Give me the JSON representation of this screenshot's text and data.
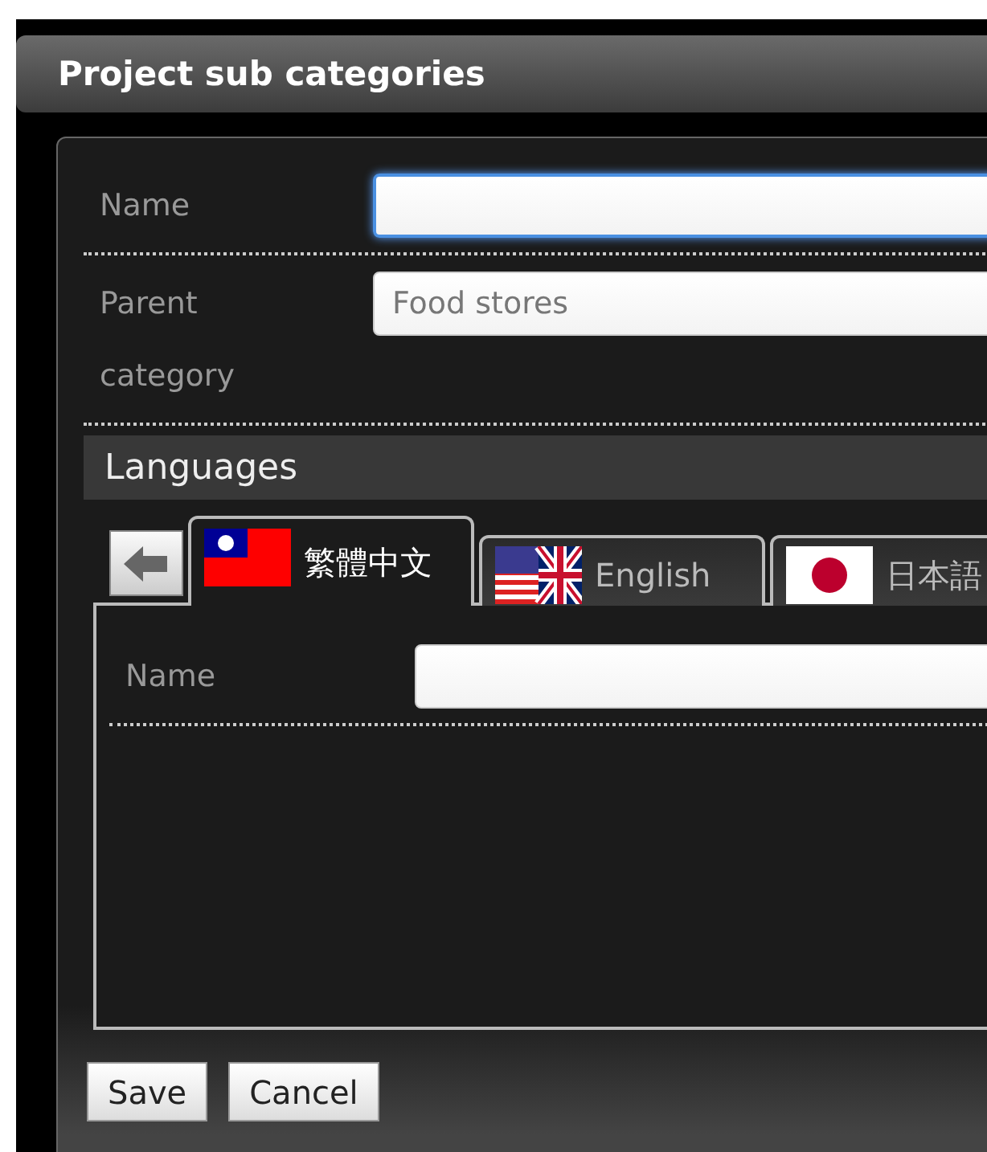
{
  "window": {
    "title": "Project sub categories"
  },
  "fields": [
    {
      "label": "Name",
      "focused": true
    },
    {
      "label": "Parent category",
      "value": "Food stores",
      "focused": false
    }
  ],
  "languages": {
    "title": "Languages",
    "tabs": [
      {
        "label": "繁體中文",
        "kind": "taiwan",
        "selected": true
      },
      {
        "label": "English",
        "kind": "usuk",
        "selected": false
      },
      {
        "label": "日本語",
        "kind": "japan",
        "selected": false
      }
    ],
    "fields": [
      {
        "label": "Name"
      }
    ]
  },
  "buttons": [
    "Save",
    "Cancel"
  ]
}
